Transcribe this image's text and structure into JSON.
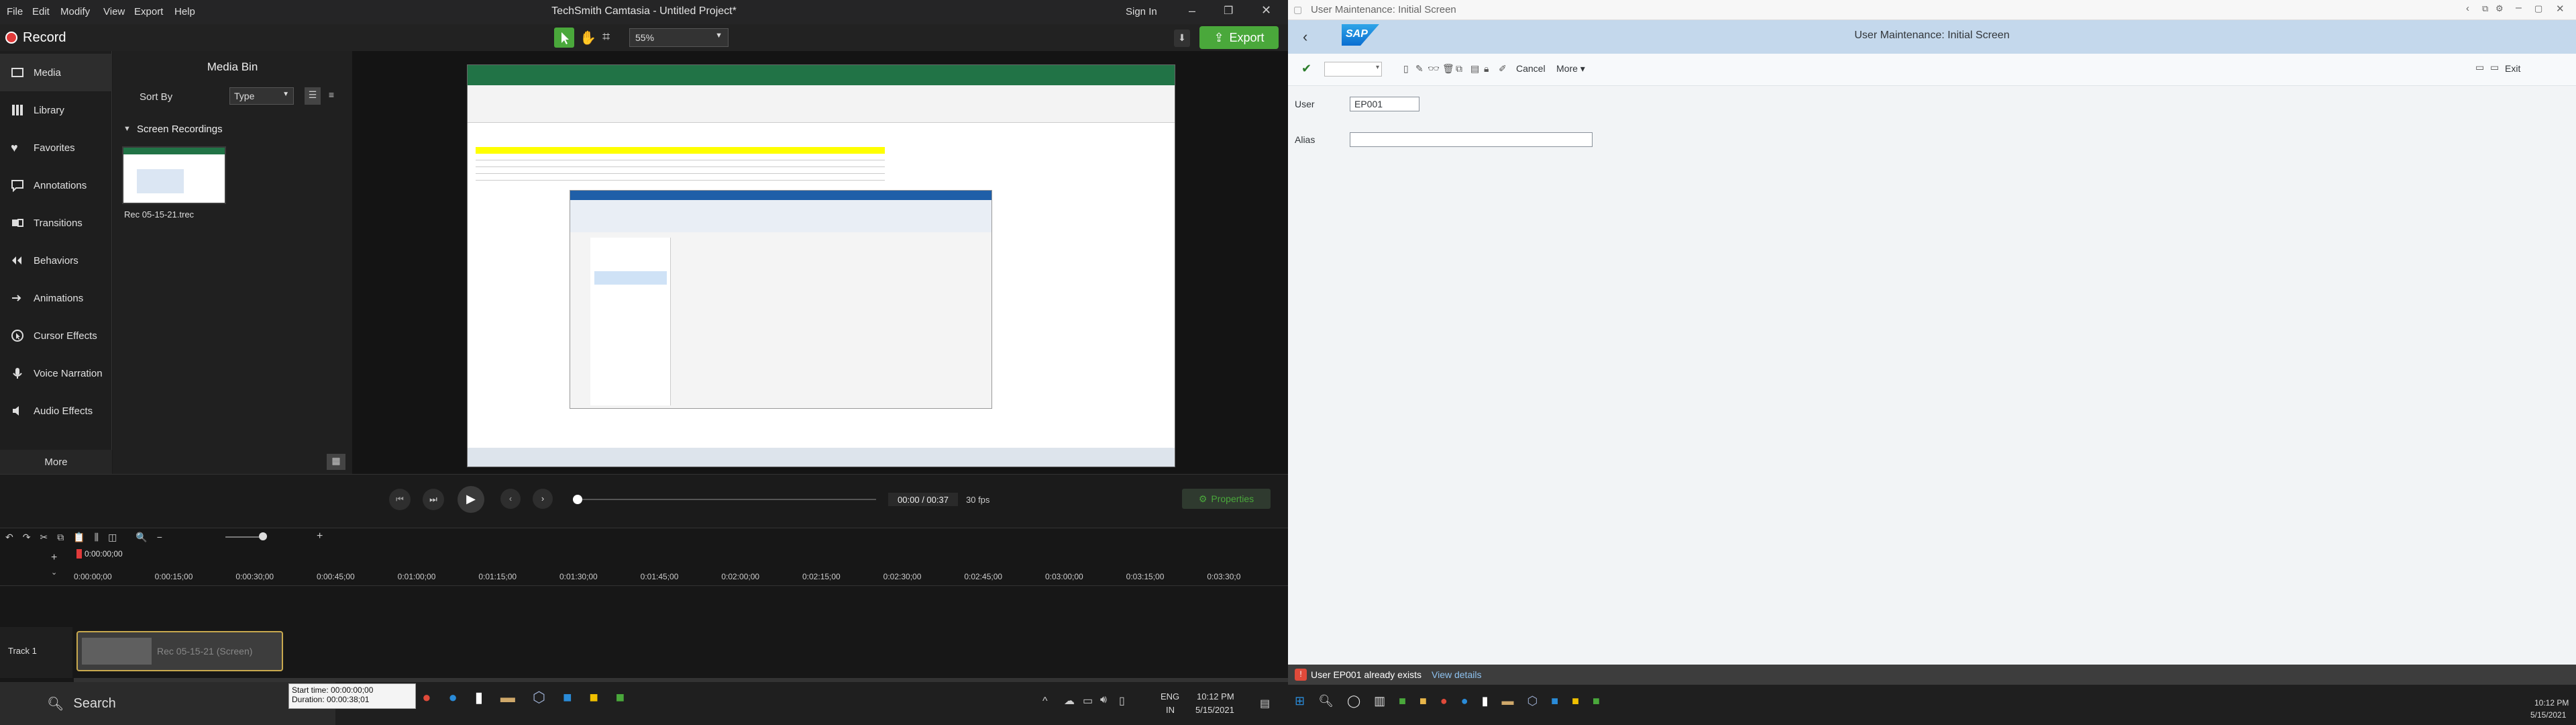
{
  "camtasia": {
    "title": "TechSmith Camtasia - Untitled Project*",
    "menu": [
      "File",
      "Edit",
      "Modify",
      "View",
      "Export",
      "Help"
    ],
    "sign_in": "Sign In",
    "record_label": "Record",
    "export_label": "Export",
    "zoom": "55%",
    "sidebar": [
      "Media",
      "Library",
      "Favorites",
      "Annotations",
      "Transitions",
      "Behaviors",
      "Animations",
      "Cursor Effects",
      "Voice Narration",
      "Audio Effects"
    ],
    "more": "More",
    "media_bin": {
      "title": "Media Bin",
      "sort_by_label": "Sort By",
      "sort_value": "Type",
      "group": "Screen Recordings",
      "clip_name": "Rec 05-15-21.trec"
    },
    "player": {
      "time": "00:00 / 00:37",
      "fps": "30 fps",
      "properties": "Properties"
    },
    "timeline": {
      "playhead": "0:00:00;00",
      "ticks": [
        "0:00:00;00",
        "0:00:15;00",
        "0:00:30;00",
        "0:00:45;00",
        "0:01:00;00",
        "0:01:15;00",
        "0:01:30;00",
        "0:01:45;00",
        "0:02:00;00",
        "0:02:15;00",
        "0:02:30;00",
        "0:02:45;00",
        "0:03:00;00",
        "0:03:15;00",
        "0:03:30;0"
      ],
      "track": "Track 1",
      "clip": "Rec 05-15-21 (Screen)",
      "tooltip_start": "Start time:  00:00:00;00",
      "tooltip_duration": "Duration:   00:00:38;01"
    },
    "taskbar": {
      "search": "Search",
      "lang": "ENG",
      "region": "IN",
      "time": "10:12 PM",
      "date": "5/15/2021"
    }
  },
  "sap": {
    "window_title": "User Maintenance: Initial Screen",
    "page_title": "User Maintenance: Initial Screen",
    "logo": "SAP",
    "cancel": "Cancel",
    "more": "More",
    "exit": "Exit",
    "user_label": "User",
    "user_value": "EP001",
    "alias_label": "Alias",
    "alias_value": "",
    "status_message": "User EP001 already exists",
    "view_details": "View details",
    "taskbar": {
      "time": "10:12 PM",
      "date": "5/15/2021"
    }
  },
  "colors": {
    "accent_green": "#4aa83b",
    "record_red": "#e03a3a",
    "sap_band": "#c4d8ec",
    "sap_blue": "#0a6ed1"
  }
}
